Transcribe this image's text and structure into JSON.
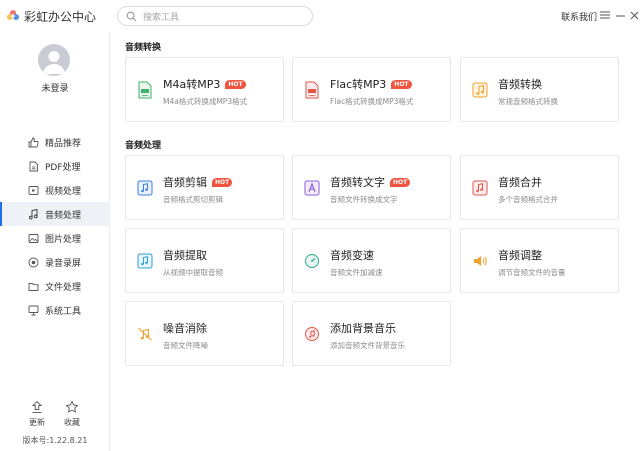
{
  "app": {
    "title": "彩虹办公中心",
    "contact": "联系我们"
  },
  "search": {
    "placeholder": "搜索工具"
  },
  "user": {
    "login_text": "未登录"
  },
  "sidebar": {
    "items": [
      {
        "label": "精品推荐",
        "icon": "thumbs-up-icon",
        "active": false
      },
      {
        "label": "PDF处理",
        "icon": "pdf-icon",
        "active": false
      },
      {
        "label": "视频处理",
        "icon": "video-icon",
        "active": false
      },
      {
        "label": "音频处理",
        "icon": "music-note-icon",
        "active": true
      },
      {
        "label": "图片处理",
        "icon": "image-icon",
        "active": false
      },
      {
        "label": "录音录屏",
        "icon": "record-icon",
        "active": false
      },
      {
        "label": "文件处理",
        "icon": "folder-icon",
        "active": false
      },
      {
        "label": "系统工具",
        "icon": "system-icon",
        "active": false
      }
    ],
    "update_label": "更新",
    "favorite_label": "收藏",
    "version": "版本号:1.22.8.21"
  },
  "sections": [
    {
      "title": "音频转换",
      "tools": [
        {
          "title": "M4a转MP3",
          "desc": "M4a格式转换成MP3格式",
          "hot": true,
          "badge": "HOT",
          "icon": "m4a-mp3-icon",
          "color": "#3fb06a"
        },
        {
          "title": "Flac转MP3",
          "desc": "Flac格式转换成MP3格式",
          "hot": true,
          "badge": "HOT",
          "icon": "flac-mp3-icon",
          "color": "#e2574c"
        },
        {
          "title": "音频转换",
          "desc": "常规音频格式转换",
          "hot": false,
          "badge": "",
          "icon": "audio-convert-icon",
          "color": "#f0a22e"
        }
      ]
    },
    {
      "title": "音频处理",
      "tools": [
        {
          "title": "音频剪辑",
          "desc": "音频格式剪切剪辑",
          "hot": true,
          "badge": "HOT",
          "icon": "audio-cut-icon",
          "color": "#3a7de0"
        },
        {
          "title": "音频转文字",
          "desc": "音频文件转换成文字",
          "hot": true,
          "badge": "HOT",
          "icon": "audio-to-text-icon",
          "color": "#8a5cd6"
        },
        {
          "title": "音频合并",
          "desc": "多个音频格式合并",
          "hot": false,
          "badge": "",
          "icon": "audio-merge-icon",
          "color": "#e2574c"
        },
        {
          "title": "音频提取",
          "desc": "从视频中提取音频",
          "hot": false,
          "badge": "",
          "icon": "audio-extract-icon",
          "color": "#2e9fd6"
        },
        {
          "title": "音频变速",
          "desc": "音频文件加减速",
          "hot": false,
          "badge": "",
          "icon": "audio-speed-icon",
          "color": "#2fae8e"
        },
        {
          "title": "音频调整",
          "desc": "调节音频文件的音量",
          "hot": false,
          "badge": "",
          "icon": "volume-icon",
          "color": "#f0a22e"
        },
        {
          "title": "噪音消除",
          "desc": "音频文件降噪",
          "hot": false,
          "badge": "",
          "icon": "noise-removal-icon",
          "color": "#f0a22e"
        },
        {
          "title": "添加背景音乐",
          "desc": "添加音频文件背景音乐",
          "hot": false,
          "badge": "",
          "icon": "background-music-icon",
          "color": "#e2574c"
        }
      ]
    }
  ]
}
